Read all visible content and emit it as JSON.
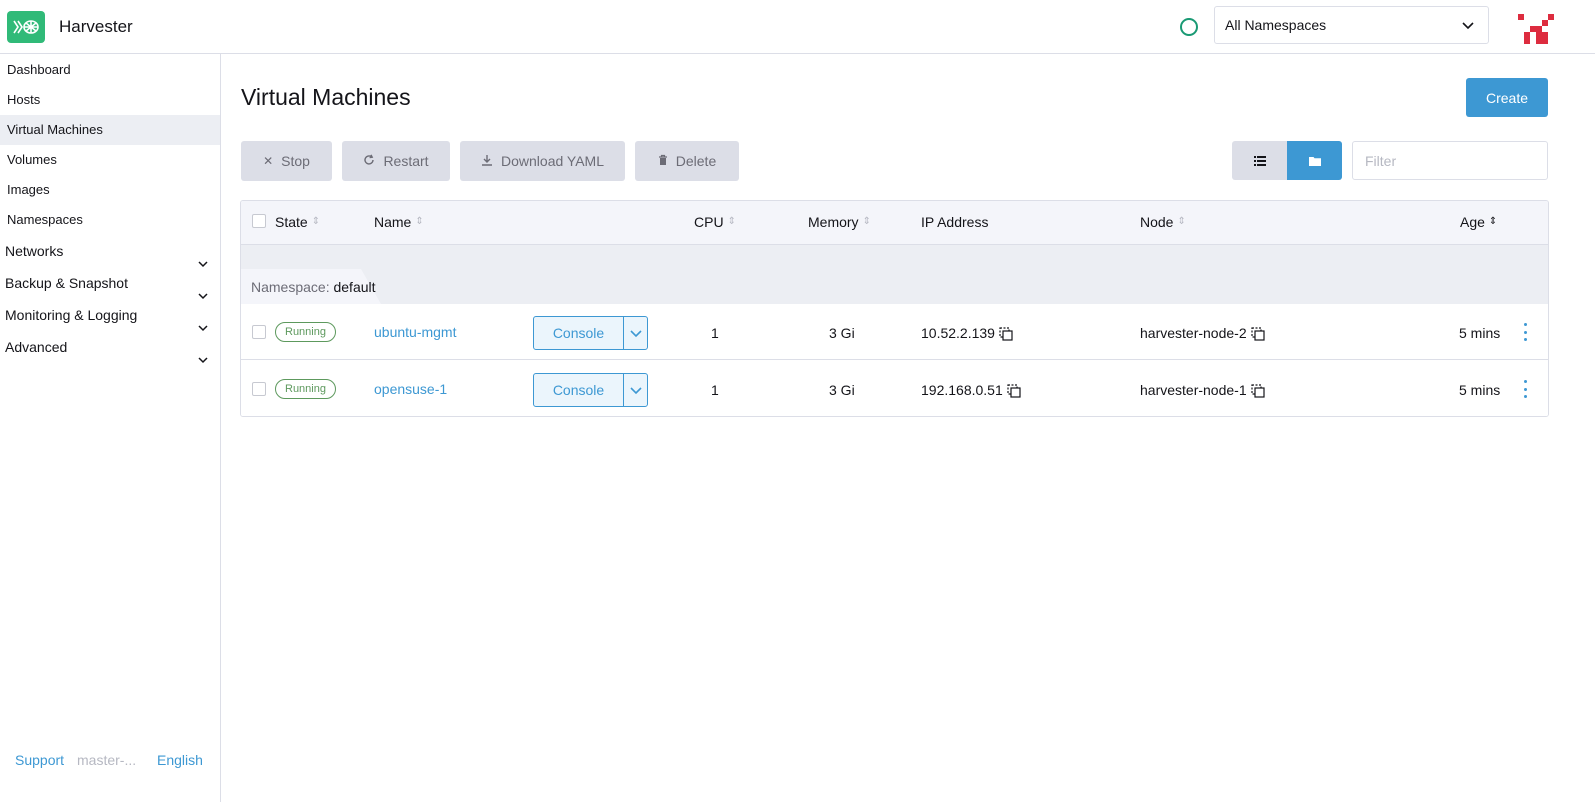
{
  "app": {
    "title": "Harvester"
  },
  "header": {
    "namespace_select": "All Namespaces"
  },
  "sidebar": {
    "items": [
      {
        "label": "Dashboard"
      },
      {
        "label": "Hosts"
      },
      {
        "label": "Virtual Machines",
        "active": true
      },
      {
        "label": "Volumes"
      },
      {
        "label": "Images"
      },
      {
        "label": "Namespaces"
      }
    ],
    "groups": [
      {
        "label": "Networks"
      },
      {
        "label": "Backup & Snapshot"
      },
      {
        "label": "Monitoring & Logging"
      },
      {
        "label": "Advanced"
      }
    ],
    "footer": {
      "support": "Support",
      "version": "master-...",
      "language": "English"
    }
  },
  "page": {
    "title": "Virtual Machines",
    "create_label": "Create",
    "bulk_actions": {
      "stop": "Stop",
      "restart": "Restart",
      "download_yaml": "Download YAML",
      "delete": "Delete"
    },
    "filter_placeholder": "Filter"
  },
  "table": {
    "columns": {
      "state": "State",
      "name": "Name",
      "cpu": "CPU",
      "memory": "Memory",
      "ip": "IP Address",
      "node": "Node",
      "age": "Age"
    },
    "group": {
      "prefix": "Namespace:",
      "name": "default"
    },
    "rows": [
      {
        "state": "Running",
        "name": "ubuntu-mgmt",
        "console": "Console",
        "cpu": "1",
        "memory": "3 Gi",
        "ip": "10.52.2.139",
        "node": "harvester-node-2",
        "age": "5 mins"
      },
      {
        "state": "Running",
        "name": "opensuse-1",
        "console": "Console",
        "cpu": "1",
        "memory": "3 Gi",
        "ip": "192.168.0.51",
        "node": "harvester-node-1",
        "age": "5 mins"
      }
    ]
  },
  "colors": {
    "accent": "#3d98d3",
    "brand": "#30ba78",
    "running": "#5d995d"
  }
}
